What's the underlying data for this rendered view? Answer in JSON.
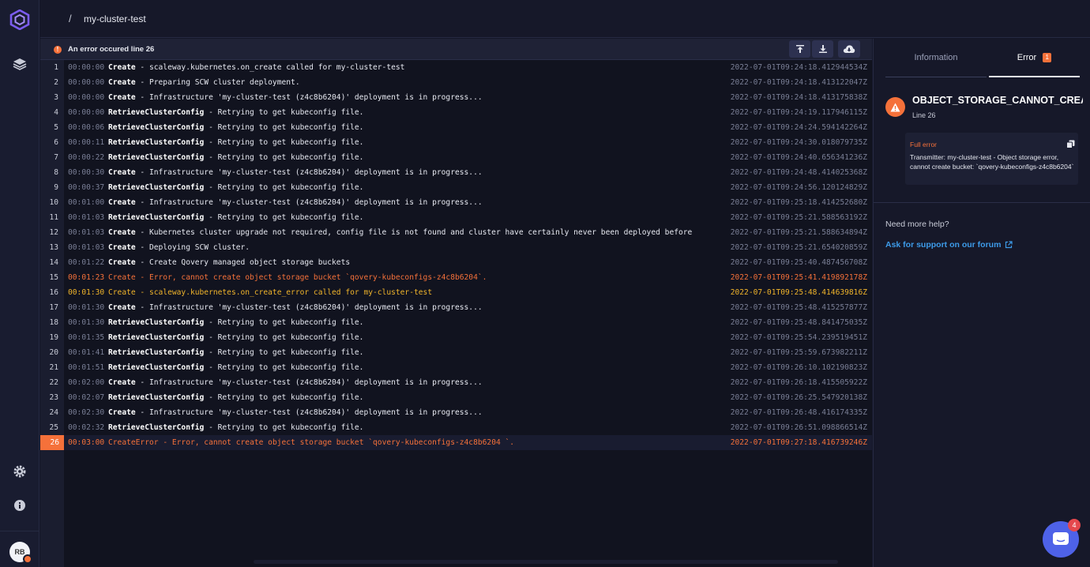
{
  "breadcrumb": {
    "separator": "/",
    "cluster": "my-cluster-test"
  },
  "user": {
    "initials": "RB"
  },
  "logs": {
    "header_message": "An error occured line 26",
    "rows": [
      {
        "n": "1",
        "time": "00:00:00",
        "step": "Create",
        "message": " - scaleway.kubernetes.on_create called for my-cluster-test",
        "ts": "2022-07-01T09:24:18.412944534Z",
        "level": "info"
      },
      {
        "n": "2",
        "time": "00:00:00",
        "step": "Create",
        "message": " - Preparing SCW cluster deployment.",
        "ts": "2022-07-01T09:24:18.413122047Z",
        "level": "info"
      },
      {
        "n": "3",
        "time": "00:00:00",
        "step": "Create",
        "message": " - Infrastructure 'my-cluster-test (z4c8b6204)' deployment is in progress...",
        "ts": "2022-07-01T09:24:18.413175838Z",
        "level": "info"
      },
      {
        "n": "4",
        "time": "00:00:00",
        "step": "RetrieveClusterConfig",
        "message": " - Retrying to get kubeconfig file.",
        "ts": "2022-07-01T09:24:19.117946115Z",
        "level": "info"
      },
      {
        "n": "5",
        "time": "00:00:06",
        "step": "RetrieveClusterConfig",
        "message": " - Retrying to get kubeconfig file.",
        "ts": "2022-07-01T09:24:24.594142264Z",
        "level": "info"
      },
      {
        "n": "6",
        "time": "00:00:11",
        "step": "RetrieveClusterConfig",
        "message": " - Retrying to get kubeconfig file.",
        "ts": "2022-07-01T09:24:30.018079735Z",
        "level": "info"
      },
      {
        "n": "7",
        "time": "00:00:22",
        "step": "RetrieveClusterConfig",
        "message": " - Retrying to get kubeconfig file.",
        "ts": "2022-07-01T09:24:40.656341236Z",
        "level": "info"
      },
      {
        "n": "8",
        "time": "00:00:30",
        "step": "Create",
        "message": " - Infrastructure 'my-cluster-test (z4c8b6204)' deployment is in progress...",
        "ts": "2022-07-01T09:24:48.414025368Z",
        "level": "info"
      },
      {
        "n": "9",
        "time": "00:00:37",
        "step": "RetrieveClusterConfig",
        "message": " - Retrying to get kubeconfig file.",
        "ts": "2022-07-01T09:24:56.120124829Z",
        "level": "info"
      },
      {
        "n": "10",
        "time": "00:01:00",
        "step": "Create",
        "message": " - Infrastructure 'my-cluster-test (z4c8b6204)' deployment is in progress...",
        "ts": "2022-07-01T09:25:18.414252680Z",
        "level": "info"
      },
      {
        "n": "11",
        "time": "00:01:03",
        "step": "RetrieveClusterConfig",
        "message": " - Retrying to get kubeconfig file.",
        "ts": "2022-07-01T09:25:21.588563192Z",
        "level": "info"
      },
      {
        "n": "12",
        "time": "00:01:03",
        "step": "Create",
        "message": " - Kubernetes cluster upgrade not required, config file is not found and cluster have certainly never been deployed before",
        "ts": "2022-07-01T09:25:21.588634894Z",
        "level": "info"
      },
      {
        "n": "13",
        "time": "00:01:03",
        "step": "Create",
        "message": " - Deploying SCW cluster.",
        "ts": "2022-07-01T09:25:21.654020859Z",
        "level": "info"
      },
      {
        "n": "14",
        "time": "00:01:22",
        "step": "Create",
        "message": " - Create Qovery managed object storage buckets",
        "ts": "2022-07-01T09:25:40.487456708Z",
        "level": "info"
      },
      {
        "n": "15",
        "time": "00:01:23",
        "step": "Create",
        "message": " - Error, cannot create object storage bucket `qovery-kubeconfigs-z4c8b6204`.",
        "ts": "2022-07-01T09:25:41.419892178Z",
        "level": "error"
      },
      {
        "n": "16",
        "time": "00:01:30",
        "step": "Create",
        "message": " - scaleway.kubernetes.on_create_error called for my-cluster-test",
        "ts": "2022-07-01T09:25:48.414639816Z",
        "level": "warning"
      },
      {
        "n": "17",
        "time": "00:01:30",
        "step": "Create",
        "message": " - Infrastructure 'my-cluster-test (z4c8b6204)' deployment is in progress...",
        "ts": "2022-07-01T09:25:48.415257877Z",
        "level": "info"
      },
      {
        "n": "18",
        "time": "00:01:30",
        "step": "RetrieveClusterConfig",
        "message": " - Retrying to get kubeconfig file.",
        "ts": "2022-07-01T09:25:48.841475035Z",
        "level": "info"
      },
      {
        "n": "19",
        "time": "00:01:35",
        "step": "RetrieveClusterConfig",
        "message": " - Retrying to get kubeconfig file.",
        "ts": "2022-07-01T09:25:54.239519451Z",
        "level": "info"
      },
      {
        "n": "20",
        "time": "00:01:41",
        "step": "RetrieveClusterConfig",
        "message": " - Retrying to get kubeconfig file.",
        "ts": "2022-07-01T09:25:59.673982211Z",
        "level": "info"
      },
      {
        "n": "21",
        "time": "00:01:51",
        "step": "RetrieveClusterConfig",
        "message": " - Retrying to get kubeconfig file.",
        "ts": "2022-07-01T09:26:10.102190823Z",
        "level": "info"
      },
      {
        "n": "22",
        "time": "00:02:00",
        "step": "Create",
        "message": " - Infrastructure 'my-cluster-test (z4c8b6204)' deployment is in progress...",
        "ts": "2022-07-01T09:26:18.415505922Z",
        "level": "info"
      },
      {
        "n": "23",
        "time": "00:02:07",
        "step": "RetrieveClusterConfig",
        "message": " - Retrying to get kubeconfig file.",
        "ts": "2022-07-01T09:26:25.547920138Z",
        "level": "info"
      },
      {
        "n": "24",
        "time": "00:02:30",
        "step": "Create",
        "message": " - Infrastructure 'my-cluster-test (z4c8b6204)' deployment is in progress...",
        "ts": "2022-07-01T09:26:48.416174335Z",
        "level": "info"
      },
      {
        "n": "25",
        "time": "00:02:32",
        "step": "RetrieveClusterConfig",
        "message": " - Retrying to get kubeconfig file.",
        "ts": "2022-07-01T09:26:51.098866514Z",
        "level": "info"
      },
      {
        "n": "26",
        "time": "00:03:00",
        "step": "CreateError",
        "message": " - Error, cannot create object storage bucket `qovery-kubeconfigs-z4c8b6204 `.",
        "ts": "2022-07-01T09:27:18.416739246Z",
        "level": "active"
      }
    ]
  },
  "sidebar_right": {
    "tabs": {
      "information": "Information",
      "error": "Error",
      "error_count": "1"
    },
    "error_title": "OBJECT_STORAGE_CANNOT_CREATE...",
    "error_line": "Line 26",
    "full_error_label": "Full error",
    "full_error_text": "Transmitter: my-cluster-test - Object storage error, cannot create bucket: `qovery-kubeconfigs-z4c8b6204`",
    "help_text": "Need more help?",
    "forum_link": "Ask for support on our forum"
  },
  "chat": {
    "badge": "4"
  },
  "colors": {
    "accent_error": "#f5713a",
    "accent_warning": "#f0b42b",
    "link": "#3d9be9",
    "chat": "#4e62e8"
  }
}
